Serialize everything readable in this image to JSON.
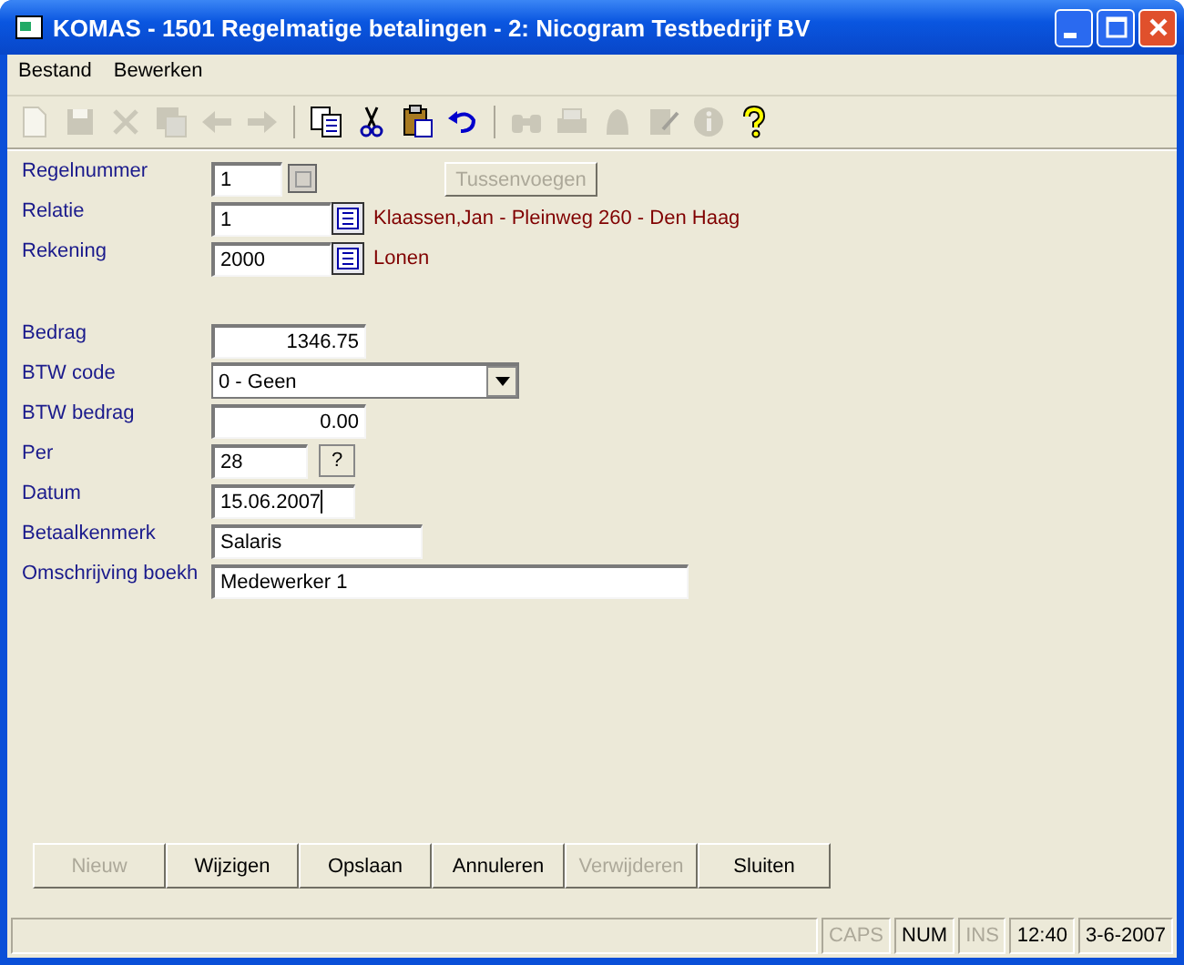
{
  "window": {
    "title": "KOMAS - 1501 Regelmatige betalingen - 2: Nicogram Testbedrijf BV"
  },
  "menu": [
    {
      "label": "Bestand"
    },
    {
      "label": "Bewerken"
    }
  ],
  "toolbar": [
    {
      "kind": "new",
      "disabled": true
    },
    {
      "kind": "save",
      "disabled": true
    },
    {
      "kind": "delete",
      "disabled": true
    },
    {
      "kind": "saveall",
      "disabled": true
    },
    {
      "kind": "back",
      "disabled": true
    },
    {
      "kind": "forward",
      "disabled": true
    },
    {
      "kind": "sep"
    },
    {
      "kind": "copy",
      "disabled": false
    },
    {
      "kind": "cut",
      "disabled": false
    },
    {
      "kind": "paste",
      "disabled": false
    },
    {
      "kind": "undo",
      "disabled": false
    },
    {
      "kind": "sep"
    },
    {
      "kind": "find",
      "disabled": true
    },
    {
      "kind": "print",
      "disabled": true
    },
    {
      "kind": "bell",
      "disabled": true
    },
    {
      "kind": "note",
      "disabled": true
    },
    {
      "kind": "info",
      "disabled": true
    },
    {
      "kind": "help",
      "disabled": false
    }
  ],
  "fields": [
    {
      "kind": "spin",
      "label": "Regelnummer",
      "value": "1",
      "button": {
        "label": "Tussenvoegen",
        "disabled": true
      }
    },
    {
      "kind": "lookup",
      "label": "Relatie",
      "value": "1",
      "description": "Klaassen,Jan - Pleinweg 260 - Den Haag"
    },
    {
      "kind": "lookup",
      "label": "Rekening",
      "value": "2000",
      "description": "Lonen"
    },
    {
      "kind": "gap"
    },
    {
      "kind": "amount",
      "label": "Bedrag",
      "value": "1346.75"
    },
    {
      "kind": "combo",
      "label": "BTW code",
      "value": "0 - Geen"
    },
    {
      "kind": "amount",
      "label": "BTW bedrag",
      "value": "0.00"
    },
    {
      "kind": "help",
      "label": "Per",
      "value": "28",
      "help": "?"
    },
    {
      "kind": "text",
      "label": "Datum",
      "value": "15.06.2007",
      "focused": true
    },
    {
      "kind": "text",
      "label": "Betaalkenmerk",
      "value": "Salaris"
    },
    {
      "kind": "text",
      "label": "Omschrijving boekh",
      "value": "Medewerker 1"
    }
  ],
  "buttons": [
    {
      "label": "Nieuw",
      "disabled": true
    },
    {
      "label": "Wijzigen",
      "disabled": false
    },
    {
      "label": "Opslaan",
      "disabled": false
    },
    {
      "label": "Annuleren",
      "disabled": false
    },
    {
      "label": "Verwijderen",
      "disabled": true
    },
    {
      "label": "Sluiten",
      "disabled": false
    }
  ],
  "status_bar": [
    {
      "label": "CAPS",
      "on": false
    },
    {
      "label": "NUM",
      "on": true
    },
    {
      "label": "INS",
      "on": false
    },
    {
      "label": "12:40",
      "on": true
    },
    {
      "label": "3-6-2007",
      "on": true
    }
  ]
}
